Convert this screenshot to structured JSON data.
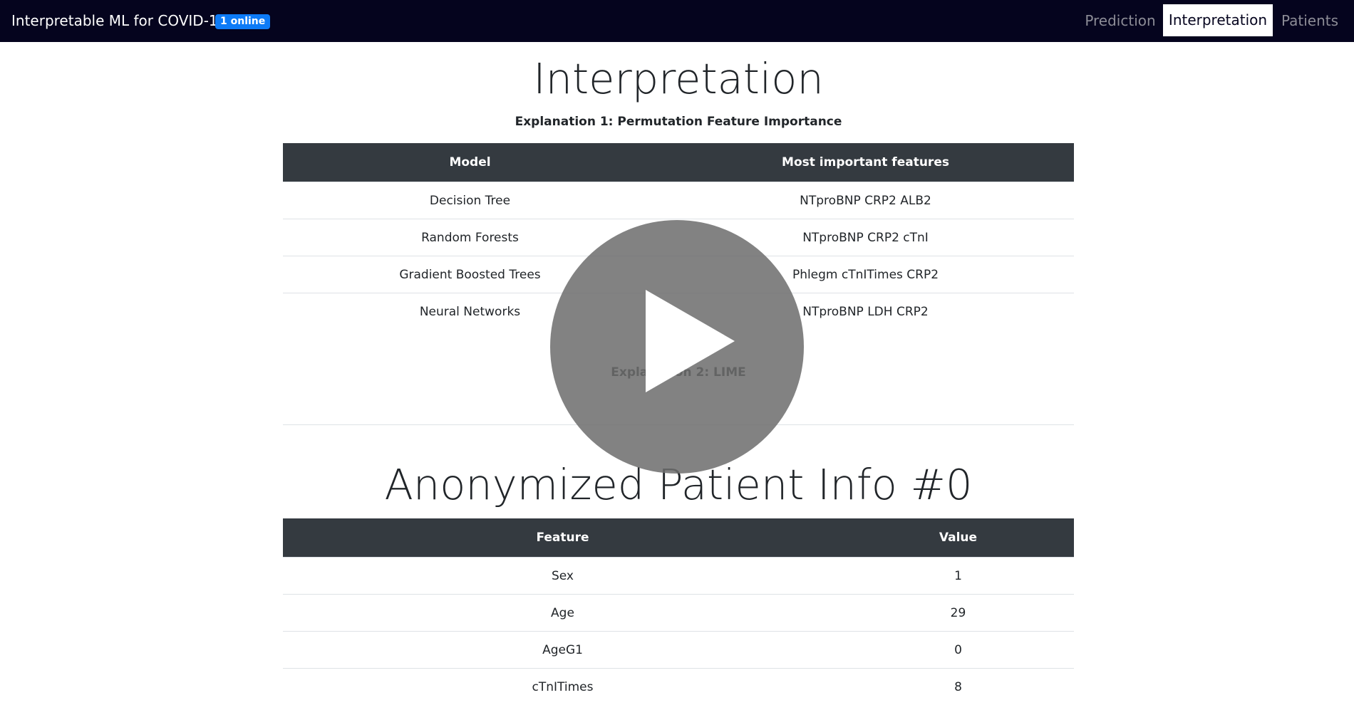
{
  "navbar": {
    "brand": "Interpretable ML for COVID-19",
    "online_badge": "1 online",
    "items": [
      {
        "label": "Prediction"
      },
      {
        "label": "Interpretation"
      },
      {
        "label": "Patients"
      }
    ],
    "active_item": "Interpretation"
  },
  "interpretation": {
    "title": "Interpretation",
    "explanation1": "Explanation 1: Permutation Feature Importance",
    "table_headers": [
      "Model",
      "Most important features"
    ],
    "rows": [
      {
        "model": "Decision Tree",
        "features": "NTproBNP CRP2 ALB2"
      },
      {
        "model": "Random Forests",
        "features": "NTproBNP CRP2 cTnI"
      },
      {
        "model": "Gradient Boosted Trees",
        "features": "Phlegm cTnITimes CRP2"
      },
      {
        "model": "Neural Networks",
        "features": "NTproBNP LDH CRP2"
      }
    ],
    "explanation2": "Explanation 2: LIME"
  },
  "patient": {
    "title": "Anonymized Patient Info #0",
    "table_headers": [
      "Feature",
      "Value"
    ],
    "rows": [
      {
        "feature": "Sex",
        "value": "1"
      },
      {
        "feature": "Age",
        "value": "29"
      },
      {
        "feature": "AgeG1",
        "value": "0"
      },
      {
        "feature": "cTnITimes",
        "value": "8"
      }
    ]
  },
  "video_overlay": {
    "icon": "play-icon"
  },
  "colors": {
    "navbar_bg": "#05041e",
    "badge_bg": "#0d7bf7",
    "table_header_bg": "#343a40"
  }
}
